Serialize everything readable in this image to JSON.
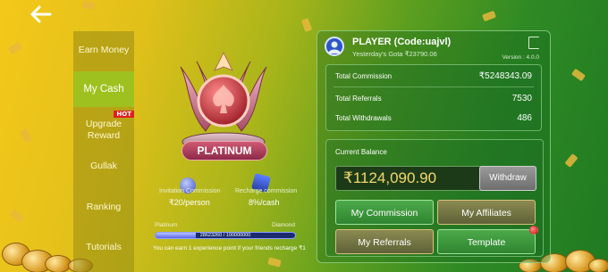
{
  "nav": {
    "back_icon": "back-arrow-icon",
    "items": [
      {
        "label": "Earn Money"
      },
      {
        "label": "My Cash",
        "active": true
      },
      {
        "label": "Upgrade Reward",
        "badge": "HOT"
      },
      {
        "label": "Gullak"
      },
      {
        "label": "Ranking"
      },
      {
        "label": "Tutorials"
      }
    ]
  },
  "level": {
    "name": "PLATINUM",
    "invitation_commission_label": "Invitation Commission",
    "invitation_commission_value": "₹20/person",
    "recharge_commission_label": "Recharge commission",
    "recharge_commission_value": "8%/cash",
    "progress_from": "Platinum",
    "progress_to": "Diamond",
    "progress_text": "28623260 / 100000000",
    "progress_fraction": 0.286,
    "progress_note": "You can earn 1 experience point if your friends recharge ₹1"
  },
  "player": {
    "name": "PLAYER (Code:uajvl)",
    "yesterday_gota": "Yesterday's Gota  ₹23790.06",
    "version": "Version : 4.0.0"
  },
  "stats": [
    {
      "label": "Total Commission",
      "value": "₹5248343.09"
    },
    {
      "label": "Total Referrals",
      "value": "7530"
    },
    {
      "label": "Total Withdrawals",
      "value": "486"
    }
  ],
  "balance": {
    "label": "Current Balance",
    "value": "₹1124,090.90",
    "withdraw_label": "Withdraw"
  },
  "actions": {
    "my_commission": "My Commission",
    "my_affiliates": "My Affiliates",
    "my_referrals": "My Referrals",
    "template": "Template"
  },
  "colors": {
    "accent_green": "#9fc11f",
    "balance_gold": "#f3d96a",
    "hot_red": "#e02020"
  }
}
